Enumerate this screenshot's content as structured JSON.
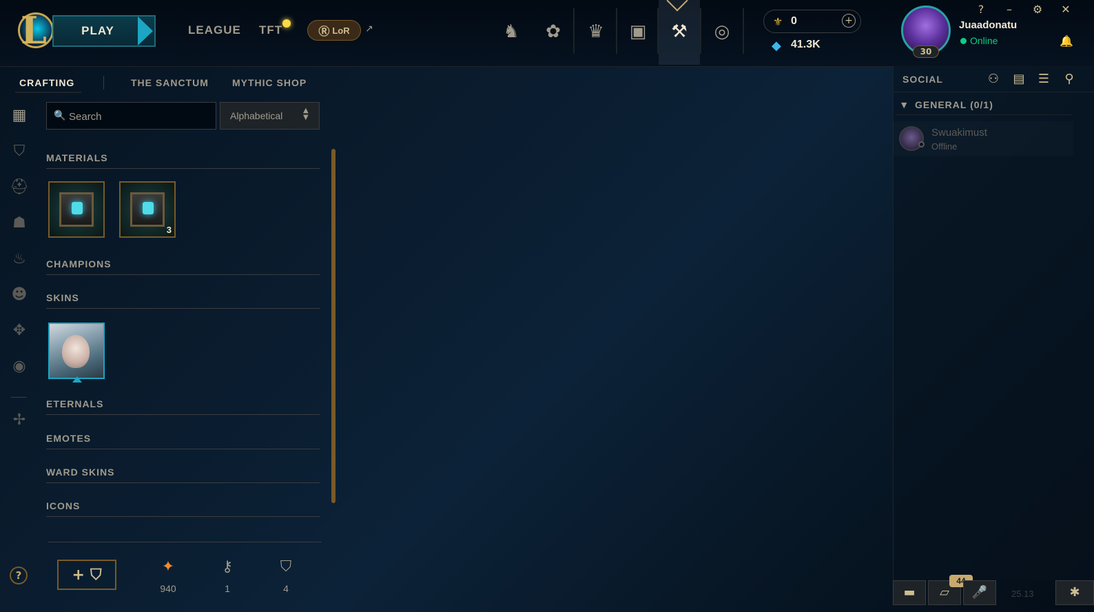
{
  "topbar": {
    "play_label": "PLAY",
    "league_label": "LEAGUE",
    "tft_label": "TFT",
    "lor_label": "LoR",
    "nav_icons": [
      "home-icon",
      "tft-icon",
      "collection-icon",
      "store-icon",
      "loot-icon",
      "currency-icon"
    ],
    "rp_value": "0",
    "be_value": "41.3K",
    "username": "Juaadonatu",
    "status": "Online",
    "level": "30",
    "window_controls": [
      "?",
      "–",
      "⚙",
      "✕"
    ]
  },
  "subnav": {
    "tabs": [
      "CRAFTING",
      "THE SANCTUM",
      "MYTHIC SHOP"
    ],
    "active": "CRAFTING"
  },
  "search": {
    "placeholder": "Search",
    "value": ""
  },
  "sort": {
    "selected": "Alphabetical"
  },
  "categories": {
    "materials": "MATERIALS",
    "champions": "CHAMPIONS",
    "skins": "SKINS",
    "eternals": "ETERNALS",
    "emotes": "EMOTES",
    "ward_skins": "WARD SKINS",
    "icons": "ICONS"
  },
  "materials": [
    {
      "name": "hextech-chest",
      "count": ""
    },
    {
      "name": "hextech-chest",
      "count": "3"
    }
  ],
  "resources": {
    "orange_essence": "940",
    "keys": "1",
    "chests": "4"
  },
  "social": {
    "title": "SOCIAL",
    "group_label": "GENERAL (0/1)",
    "friends": [
      {
        "name": "Swuakimust",
        "status": "Offline"
      }
    ]
  },
  "bottom": {
    "mission_count": "44",
    "version": "25.13"
  },
  "colors": {
    "gold": "#c8aa6e",
    "teal": "#1ca6c4",
    "online": "#0acf83",
    "background": "#0a1c2e"
  }
}
